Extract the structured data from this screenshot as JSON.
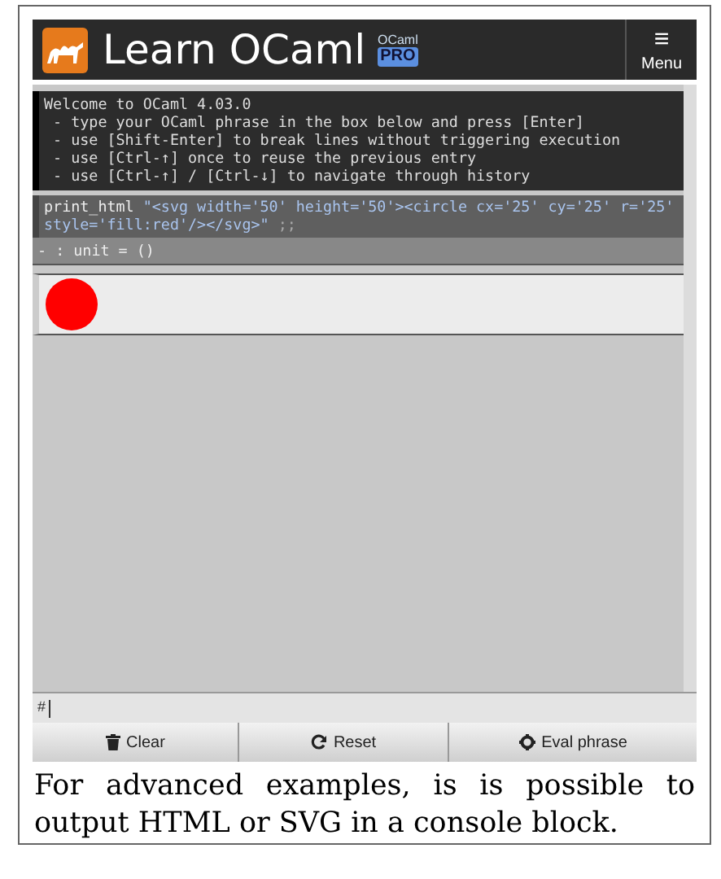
{
  "header": {
    "title": "Learn OCaml",
    "badge_top": "OCaml",
    "badge": "PRO",
    "menu_icon": "≡",
    "menu_label": "Menu"
  },
  "console": {
    "lines": [
      "Welcome to OCaml 4.03.0",
      " - type your OCaml phrase in the box below and press [Enter]",
      " - use [Shift-Enter] to break lines without triggering execution",
      " - use [Ctrl-↑] once to reuse the previous entry",
      " - use [Ctrl-↑] / [Ctrl-↓] to navigate through history"
    ]
  },
  "phrase": {
    "command": "print_html",
    "argument": "\"<svg width='50' height='50'><circle cx='25' cy='25' r='25' style='fill:red'/></svg>\"",
    "terminator": ";;"
  },
  "result": "- : unit = ()",
  "output": {
    "kind": "circle",
    "color": "#ff0000"
  },
  "prompt": "#",
  "buttons": [
    {
      "label": "Clear",
      "kind": "clear"
    },
    {
      "label": "Reset",
      "kind": "reset"
    },
    {
      "label": "Eval phrase",
      "kind": "eval"
    }
  ],
  "caption": "For advanced examples, is is possible to output HTML or SVG in a console block."
}
